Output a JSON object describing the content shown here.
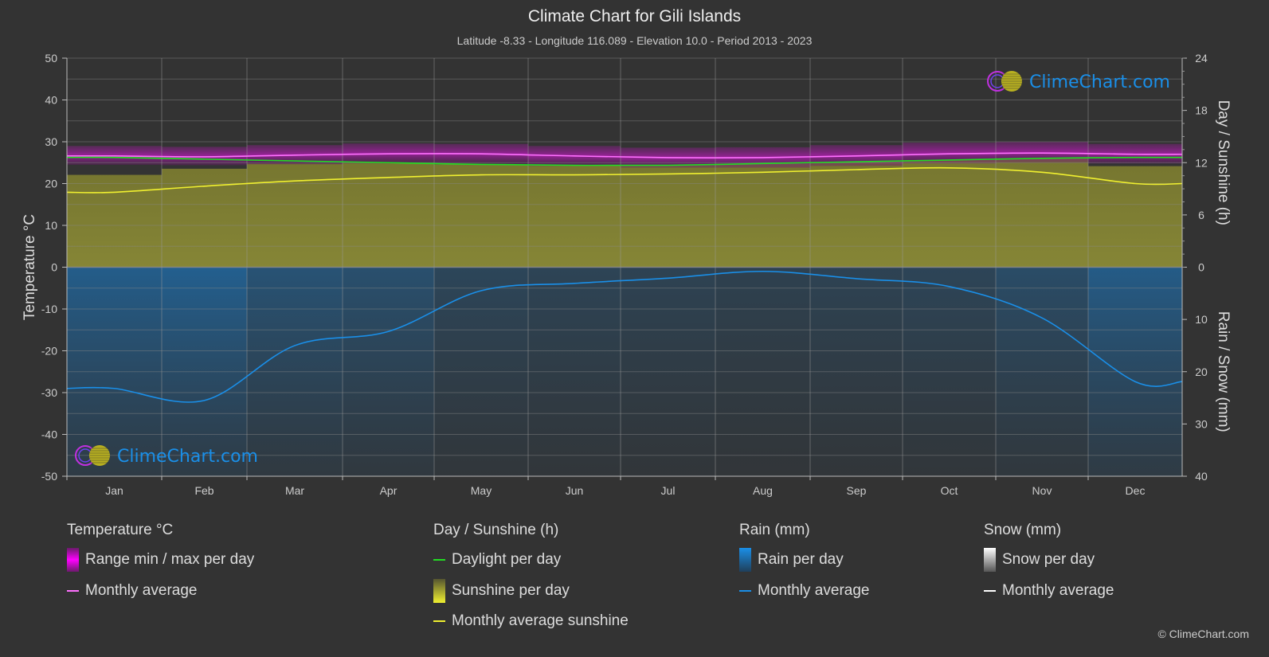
{
  "title": "Climate Chart for Gili Islands",
  "subtitle": "Latitude -8.33 - Longitude 116.089 - Elevation 10.0 - Period 2013 - 2023",
  "watermark": "ClimeChart.com",
  "copyright": "© ClimeChart.com",
  "legend": {
    "temperature": {
      "title": "Temperature °C",
      "items": [
        {
          "label": "Range min / max per day",
          "icon": "magenta-gradient-bar",
          "color": "#e020e0"
        },
        {
          "label": "Monthly average",
          "icon": "pink-line",
          "color": "#ff70ff"
        }
      ]
    },
    "sunshine": {
      "title": "Day / Sunshine (h)",
      "items": [
        {
          "label": "Daylight per day",
          "icon": "green-line",
          "color": "#22dd22"
        },
        {
          "label": "Sunshine per day",
          "icon": "yellow-gradient-bar",
          "color": "#e0e040"
        },
        {
          "label": "Monthly average sunshine",
          "icon": "yellow-line",
          "color": "#f0f030"
        }
      ]
    },
    "rain": {
      "title": "Rain (mm)",
      "items": [
        {
          "label": "Rain per day",
          "icon": "blue-gradient-bar",
          "color": "#1a8fe8"
        },
        {
          "label": "Monthly average",
          "icon": "blue-line",
          "color": "#1a8fe8"
        }
      ]
    },
    "snow": {
      "title": "Snow (mm)",
      "items": [
        {
          "label": "Snow per day",
          "icon": "white-gradient-bar",
          "color": "#dddddd"
        },
        {
          "label": "Monthly average",
          "icon": "white-line",
          "color": "#ffffff"
        }
      ]
    }
  },
  "chart_data": {
    "type": "line",
    "title": "Climate Chart for Gili Islands",
    "categories": [
      "Jan",
      "Feb",
      "Mar",
      "Apr",
      "May",
      "Jun",
      "Jul",
      "Aug",
      "Sep",
      "Oct",
      "Nov",
      "Dec"
    ],
    "y_left": {
      "label": "Temperature °C",
      "range": [
        -50,
        50
      ],
      "ticks": [
        50,
        40,
        30,
        20,
        10,
        0,
        -10,
        -20,
        -30,
        -40,
        -50
      ]
    },
    "y_right_top": {
      "label": "Day / Sunshine (h)",
      "range": [
        0,
        24
      ],
      "ticks": [
        24,
        18,
        12,
        6,
        0
      ]
    },
    "y_right_bottom": {
      "label": "Rain / Snow (mm)",
      "range": [
        0,
        40
      ],
      "ticks": [
        0,
        10,
        20,
        30,
        40
      ]
    },
    "grid": true,
    "series": [
      {
        "name": "Temperature monthly average",
        "axis": "temperature",
        "color": "#ff70ff",
        "values": [
          26.6,
          26.4,
          26.8,
          27.1,
          27.1,
          26.6,
          26.2,
          26.2,
          26.6,
          27.1,
          27.3,
          27.0
        ]
      },
      {
        "name": "Temperature daily max (approx)",
        "axis": "temperature",
        "color": "#a020a0",
        "values": [
          29.0,
          28.8,
          29.2,
          29.6,
          29.5,
          29.0,
          28.6,
          28.7,
          29.2,
          29.8,
          30.0,
          29.5
        ]
      },
      {
        "name": "Temperature daily min (approx)",
        "axis": "temperature",
        "color": "#a020a0",
        "values": [
          24.5,
          24.4,
          24.6,
          24.8,
          24.7,
          24.2,
          23.8,
          23.8,
          24.2,
          24.8,
          25.0,
          24.8
        ]
      },
      {
        "name": "Daylight per day",
        "axis": "sunshine",
        "color": "#22dd22",
        "values": [
          12.6,
          12.4,
          12.2,
          12.0,
          11.8,
          11.7,
          11.7,
          11.9,
          12.1,
          12.3,
          12.5,
          12.6
        ]
      },
      {
        "name": "Monthly average sunshine",
        "axis": "sunshine",
        "color": "#f0f030",
        "values": [
          8.6,
          9.3,
          9.9,
          10.3,
          10.6,
          10.6,
          10.7,
          10.9,
          11.2,
          11.4,
          10.9,
          9.6
        ]
      },
      {
        "name": "Rain monthly average",
        "axis": "rain",
        "color": "#1a8fe8",
        "values": [
          23.2,
          25.5,
          15.0,
          12.3,
          4.5,
          3.1,
          2.1,
          0.8,
          2.2,
          3.7,
          9.7,
          21.9
        ]
      },
      {
        "name": "Snow monthly average",
        "axis": "rain",
        "color": "#ffffff",
        "values": [
          0,
          0,
          0,
          0,
          0,
          0,
          0,
          0,
          0,
          0,
          0,
          0
        ]
      }
    ]
  }
}
